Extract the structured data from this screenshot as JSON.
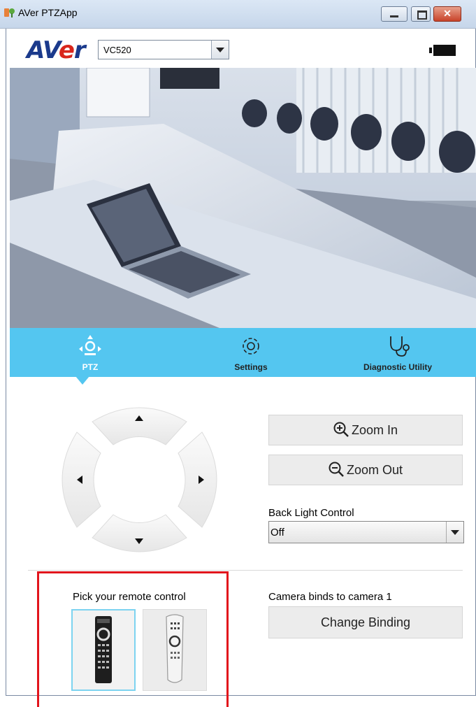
{
  "window": {
    "title": "AVer PTZApp",
    "controls": {
      "minimize": "",
      "maximize": "",
      "close": "✕"
    }
  },
  "toolbar": {
    "logo_prefix": "AV",
    "logo_e": "e",
    "logo_suffix": "r",
    "model_select": {
      "value": "VC520"
    },
    "camera_icon": "camera-icon"
  },
  "tabs": [
    {
      "label": "PTZ",
      "icon": "ptz-icon",
      "selected": true
    },
    {
      "label": "Settings",
      "icon": "gear-icon"
    },
    {
      "label": "Diagnostic Utility",
      "icon": "stethoscope-icon"
    }
  ],
  "ptz": {
    "dpad_icons": [
      "arrow-up-icon",
      "arrow-left-icon",
      "arrow-right-icon",
      "arrow-down-icon"
    ],
    "zoom_in_label": "Zoom In",
    "zoom_out_label": "Zoom Out",
    "back_light": {
      "label": "Back Light Control",
      "value": "Off"
    }
  },
  "remote": {
    "pick_label": "Pick your remote control",
    "options": [
      "remote-control-1",
      "remote-control-2"
    ],
    "selected_index": 0
  },
  "binding": {
    "status": "Camera binds to camera 1",
    "change_label": "Change Binding"
  },
  "colors": {
    "accent": "#54c6f0",
    "highlight_box": "#e2141c",
    "logo_blue": "#1b3a8c",
    "logo_red": "#d9261c"
  }
}
